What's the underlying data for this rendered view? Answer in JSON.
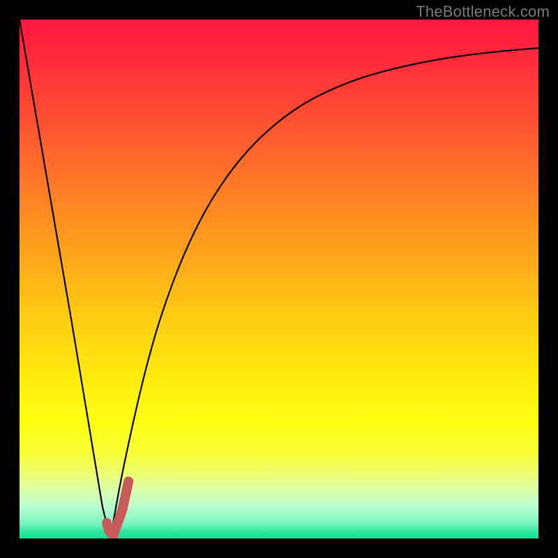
{
  "watermark": "TheBottleneck.com",
  "chart_data": {
    "type": "line",
    "title": "",
    "xlabel": "",
    "ylabel": "",
    "xlim": [
      0,
      100
    ],
    "ylim": [
      0,
      100
    ],
    "grid": false,
    "series": [
      {
        "name": "left-branch",
        "x": [
          0,
          5,
          10,
          14,
          16,
          17.5
        ],
        "values": [
          100,
          71,
          42,
          18,
          6,
          0
        ]
      },
      {
        "name": "right-branch",
        "x": [
          17.5,
          20,
          25,
          30,
          35,
          40,
          45,
          50,
          55,
          60,
          65,
          70,
          75,
          80,
          85,
          90,
          95,
          100
        ],
        "values": [
          0,
          14,
          36,
          51,
          62,
          70,
          76,
          80.5,
          84,
          86.5,
          88.5,
          90,
          91.2,
          92.2,
          93,
          93.6,
          94.1,
          94.5
        ]
      }
    ],
    "marker": {
      "name": "highlight-j",
      "points_xy": [
        [
          16.8,
          3.0
        ],
        [
          17.2,
          1.5
        ],
        [
          18.0,
          0.5
        ],
        [
          19.8,
          5.5
        ],
        [
          21.0,
          11.0
        ]
      ],
      "color": "#c85a5a"
    },
    "gradient_bg": {
      "top": "#ff173f",
      "bottom": "#1ee096"
    }
  }
}
